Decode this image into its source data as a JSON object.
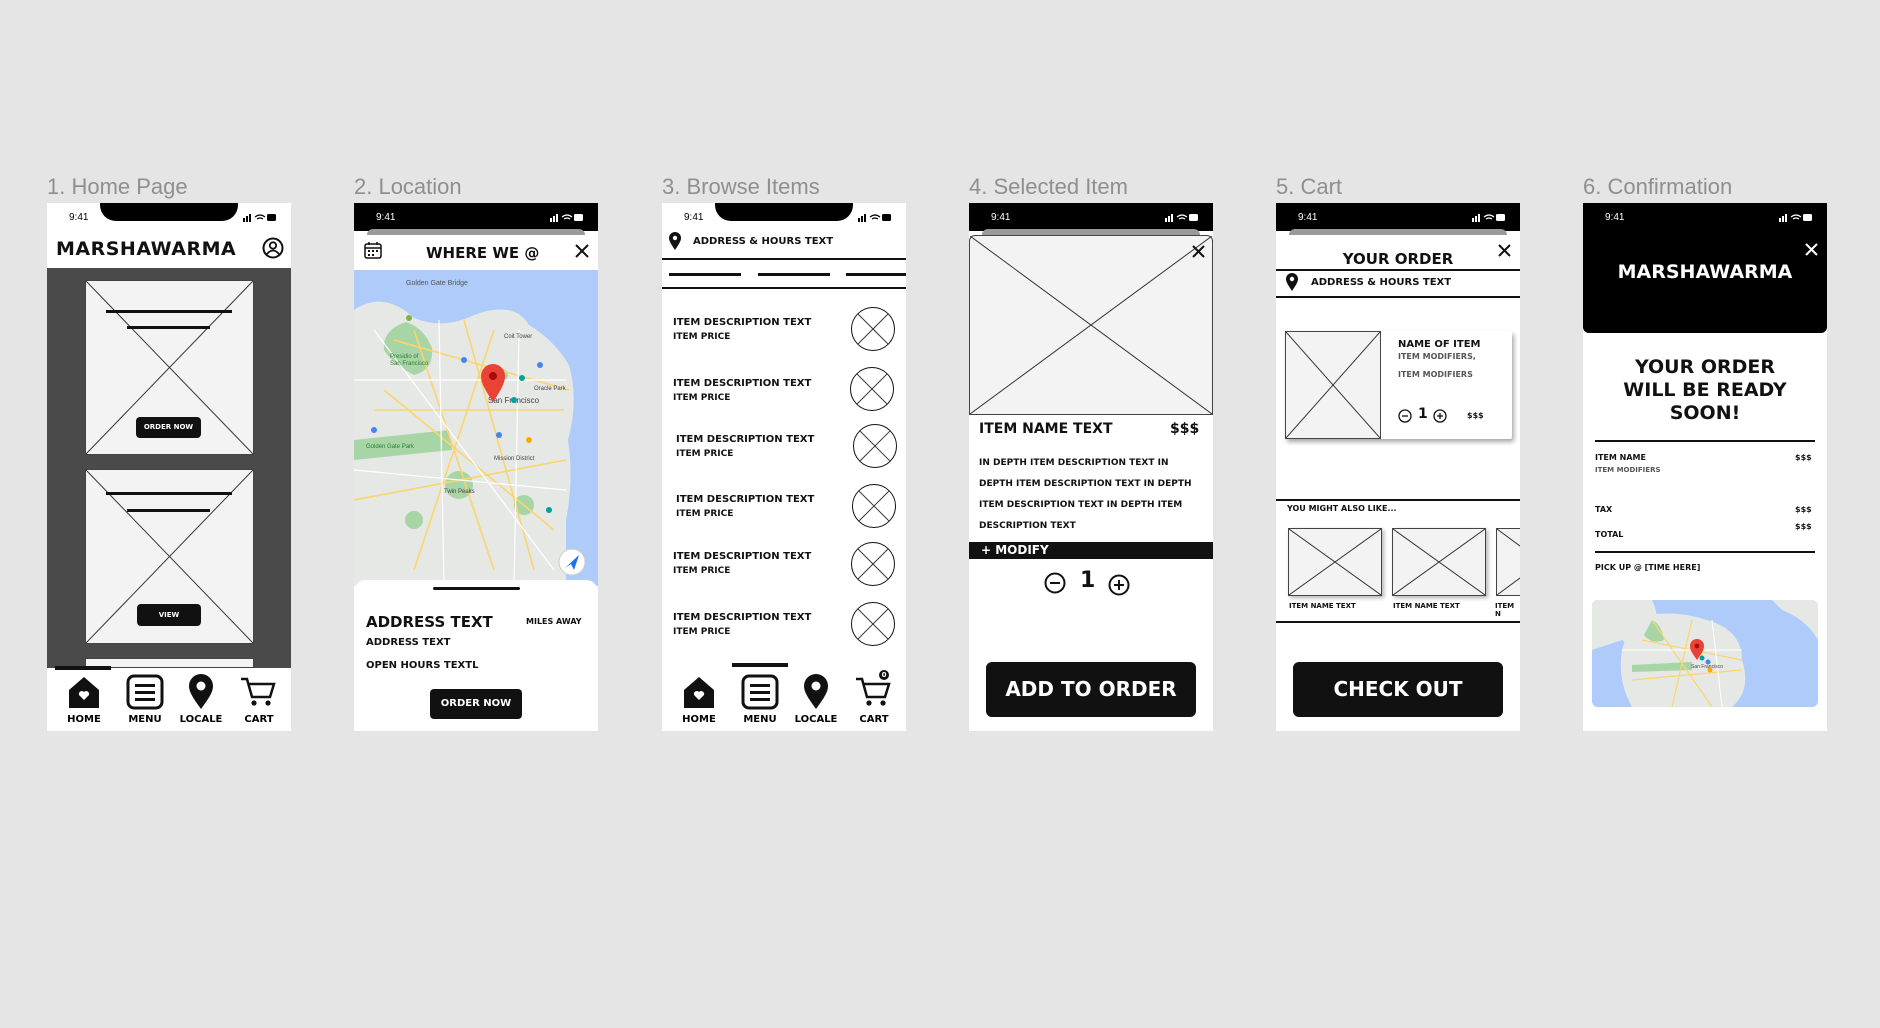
{
  "frames": [
    {
      "label": "1. Home Page"
    },
    {
      "label": "2. Location"
    },
    {
      "label": "3. Browse Items"
    },
    {
      "label": "4. Selected Item"
    },
    {
      "label": "5. Cart"
    },
    {
      "label": "6. Confirmation"
    }
  ],
  "status_time": "9:41",
  "nav": {
    "home": "HOME",
    "menu": "MENU",
    "locale": "LOCALE",
    "cart": "CART"
  },
  "home": {
    "brand": "MARSHAWARMA",
    "order_now": "ORDER NOW",
    "view": "VIEW"
  },
  "location": {
    "title": "WHERE WE @",
    "address_title": "ADDRESS TEXT",
    "miles": "MILES AWAY",
    "address": "ADDRESS TEXT",
    "hours": "OPEN HOURS TEXTL",
    "order_now": "ORDER NOW",
    "map_labels": {
      "city": "San Francisco",
      "presidio": "Presidio of San Francisco",
      "twin_peaks": "Twin Peaks",
      "coit": "Coit Tower",
      "oracle": "Oracle Park",
      "golden_gate": "Golden Gate Park",
      "mission": "Mission District"
    }
  },
  "browse": {
    "address": "ADDRESS & HOURS TEXT",
    "items": [
      {
        "desc": "ITEM DESCRIPTION TEXT",
        "price": "ITEM PRICE"
      },
      {
        "desc": "ITEM DESCRIPTION TEXT",
        "price": "ITEM PRICE"
      },
      {
        "desc": "ITEM DESCRIPTION TEXT",
        "price": "ITEM PRICE"
      },
      {
        "desc": "ITEM DESCRIPTION TEXT",
        "price": "ITEM PRICE"
      },
      {
        "desc": "ITEM DESCRIPTION TEXT",
        "price": "ITEM PRICE"
      },
      {
        "desc": "ITEM DESCRIPTION TEXT",
        "price": "ITEM PRICE"
      }
    ],
    "cart_count": "0"
  },
  "selected": {
    "name": "ITEM NAME TEXT",
    "price": "$$$",
    "desc_lines": [
      "IN DEPTH ITEM DESCRIPTION TEXT IN",
      "DEPTH ITEM DESCRIPTION TEXT IN DEPTH",
      "ITEM DESCRIPTION TEXT IN DEPTH ITEM",
      "DESCRIPTION TEXT"
    ],
    "modify": "+ MODIFY",
    "qty": "1",
    "add": "ADD TO ORDER"
  },
  "cart": {
    "title": "YOUR ORDER",
    "address": "ADDRESS & HOURS TEXT",
    "item_name": "NAME OF ITEM",
    "mod1": "ITEM MODIFIERS,",
    "mod2": "ITEM MODIFIERS",
    "qty": "1",
    "price": "$$$",
    "also": "YOU MIGHT ALSO LIKE...",
    "suggest": [
      "ITEM NAME TEXT",
      "ITEM NAME TEXT",
      "ITEM N"
    ],
    "checkout": "CHECK OUT"
  },
  "confirm": {
    "brand": "MARSHAWARMA",
    "msg1": "YOUR ORDER",
    "msg2": "WILL BE READY",
    "msg3": "SOON!",
    "item": "ITEM NAME",
    "item_price": "$$$",
    "mods": "ITEM MODIFIERS",
    "tax": "TAX",
    "tax_val": "$$$",
    "total": "TOTAL",
    "total_val": "$$$",
    "pickup": "PICK UP @ [TIME HERE]",
    "map_city": "San Francisco"
  }
}
